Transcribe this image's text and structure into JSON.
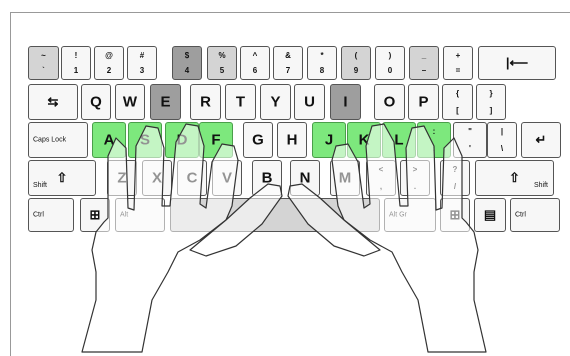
{
  "row1": [
    {
      "id": "backquote",
      "top": "~",
      "bot": "`",
      "style": "gray"
    },
    {
      "id": "1",
      "top": "!",
      "bot": "1",
      "style": "light"
    },
    {
      "id": "2",
      "top": "@",
      "bot": "2",
      "style": "light"
    },
    {
      "id": "3",
      "top": "#",
      "bot": "3",
      "style": "light"
    },
    {
      "id": "4",
      "top": "$",
      "bot": "4",
      "style": "dark"
    },
    {
      "id": "5",
      "top": "%",
      "bot": "5",
      "style": "gray"
    },
    {
      "id": "6",
      "top": "^",
      "bot": "6",
      "style": "light"
    },
    {
      "id": "7",
      "top": "&",
      "bot": "7",
      "style": "light"
    },
    {
      "id": "8",
      "top": "*",
      "bot": "8",
      "style": "light"
    },
    {
      "id": "9",
      "top": "(",
      "bot": "9",
      "style": "gray"
    },
    {
      "id": "0",
      "top": ")",
      "bot": "0",
      "style": "light"
    },
    {
      "id": "minus",
      "top": "_",
      "bot": "–",
      "style": "gray"
    },
    {
      "id": "equals",
      "top": "+",
      "bot": "=",
      "style": "light"
    },
    {
      "id": "backspace",
      "icon": "backspace-arrow-icon",
      "glyph": "|⟵",
      "style": "light"
    }
  ],
  "row2": [
    {
      "id": "tab",
      "icon": "tab-arrows-icon",
      "glyph": "⇆",
      "style": "light"
    },
    {
      "id": "q",
      "label": "Q",
      "style": "light"
    },
    {
      "id": "w",
      "label": "W",
      "style": "light"
    },
    {
      "id": "e",
      "label": "E",
      "style": "dark"
    },
    {
      "id": "r",
      "label": "R",
      "style": "light"
    },
    {
      "id": "t",
      "label": "T",
      "style": "light"
    },
    {
      "id": "y",
      "label": "Y",
      "style": "light"
    },
    {
      "id": "u",
      "label": "U",
      "style": "light"
    },
    {
      "id": "i",
      "label": "I",
      "style": "dark"
    },
    {
      "id": "o",
      "label": "O",
      "style": "light"
    },
    {
      "id": "p",
      "label": "P",
      "style": "light"
    },
    {
      "id": "lbracket",
      "top": "{",
      "bot": "[",
      "style": "light"
    },
    {
      "id": "rbracket",
      "top": "}",
      "bot": "]",
      "style": "light"
    }
  ],
  "row3": [
    {
      "id": "capslock",
      "small": "Caps Lock",
      "style": "light"
    },
    {
      "id": "a",
      "label": "A",
      "style": "green"
    },
    {
      "id": "s",
      "label": "S",
      "style": "green"
    },
    {
      "id": "d",
      "label": "D",
      "style": "green"
    },
    {
      "id": "f",
      "label": "F",
      "style": "green"
    },
    {
      "id": "g",
      "label": "G",
      "style": "light"
    },
    {
      "id": "h",
      "label": "H",
      "style": "light"
    },
    {
      "id": "j",
      "label": "J",
      "style": "green"
    },
    {
      "id": "k",
      "label": "K",
      "style": "green"
    },
    {
      "id": "l",
      "label": "L",
      "style": "green"
    },
    {
      "id": "semicolon",
      "top": ":",
      "bot": ";",
      "style": "green"
    },
    {
      "id": "quote",
      "top": "\"",
      "bot": "'",
      "style": "light"
    },
    {
      "id": "backslash",
      "top": "|",
      "bot": "\\",
      "style": "light"
    },
    {
      "id": "enter",
      "icon": "enter-arrow-icon",
      "glyph": "↵",
      "style": "light"
    }
  ],
  "row4": [
    {
      "id": "lshift",
      "small": "Shift",
      "icon": "shift-arrow-icon",
      "glyph": "⇧",
      "style": "light"
    },
    {
      "id": "z",
      "label": "Z",
      "style": "light"
    },
    {
      "id": "x",
      "label": "X",
      "style": "light"
    },
    {
      "id": "c",
      "label": "C",
      "style": "light"
    },
    {
      "id": "v",
      "label": "V",
      "style": "light"
    },
    {
      "id": "b",
      "label": "B",
      "style": "light"
    },
    {
      "id": "n",
      "label": "N",
      "style": "light"
    },
    {
      "id": "m",
      "label": "M",
      "style": "light"
    },
    {
      "id": "comma",
      "top": "<",
      "bot": ",",
      "style": "light"
    },
    {
      "id": "period",
      "top": ">",
      "bot": ".",
      "style": "light"
    },
    {
      "id": "slash",
      "top": "?",
      "bot": "/",
      "style": "light"
    },
    {
      "id": "rshift",
      "small": "Shift",
      "icon": "shift-arrow-icon",
      "glyph": "⇧",
      "style": "light"
    }
  ],
  "row5": [
    {
      "id": "lctrl",
      "small": "Ctrl",
      "style": "light"
    },
    {
      "id": "lwin",
      "icon": "windows-logo-icon",
      "glyph": "⊞",
      "style": "light"
    },
    {
      "id": "lalt",
      "small": "Alt",
      "style": "light"
    },
    {
      "id": "space",
      "label": "",
      "style": "gray"
    },
    {
      "id": "ralt",
      "small": "Alt Gr",
      "style": "light"
    },
    {
      "id": "rwin",
      "icon": "windows-logo-icon",
      "glyph": "⊞",
      "style": "light"
    },
    {
      "id": "menu",
      "icon": "menu-key-icon",
      "glyph": "▤",
      "style": "light"
    },
    {
      "id": "rctrl",
      "small": "Ctrl",
      "style": "light"
    }
  ],
  "colors": {
    "home_row": "#7de87d",
    "gray_key": "#d4d4d4",
    "dark_key": "#9e9e9e",
    "light_key": "#f7f7f7"
  }
}
